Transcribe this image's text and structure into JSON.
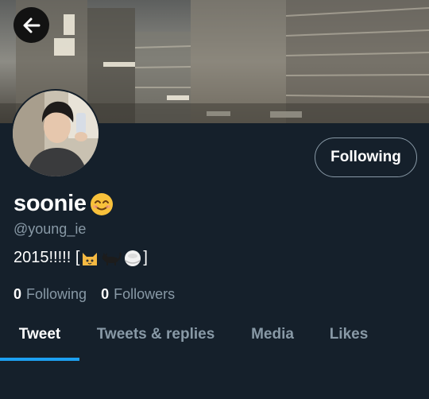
{
  "header": {
    "back_icon": "arrow-left-icon",
    "banner_description_icon": "city-night-banner"
  },
  "profile": {
    "display_name": "soonie",
    "name_emoji_icon": "smiling-face-icon",
    "handle": "@young_ie",
    "bio_text": "2015!!!!! [",
    "bio_close": "]",
    "bio_emoji_icons": [
      "cat-face-icon",
      "black-cat-icon",
      "rice-ball-icon"
    ],
    "follow_button_label": "Following",
    "following_count": "0",
    "following_label": "Following",
    "followers_count": "0",
    "followers_label": "Followers"
  },
  "tabs": [
    {
      "label": "Tweet",
      "active": true
    },
    {
      "label": "Tweets & replies",
      "active": false
    },
    {
      "label": "Media",
      "active": false
    },
    {
      "label": "Likes",
      "active": false
    }
  ],
  "colors": {
    "background": "#15202b",
    "secondary_text": "#8899a6",
    "accent": "#1da1f2",
    "primary_text": "#ffffff"
  }
}
